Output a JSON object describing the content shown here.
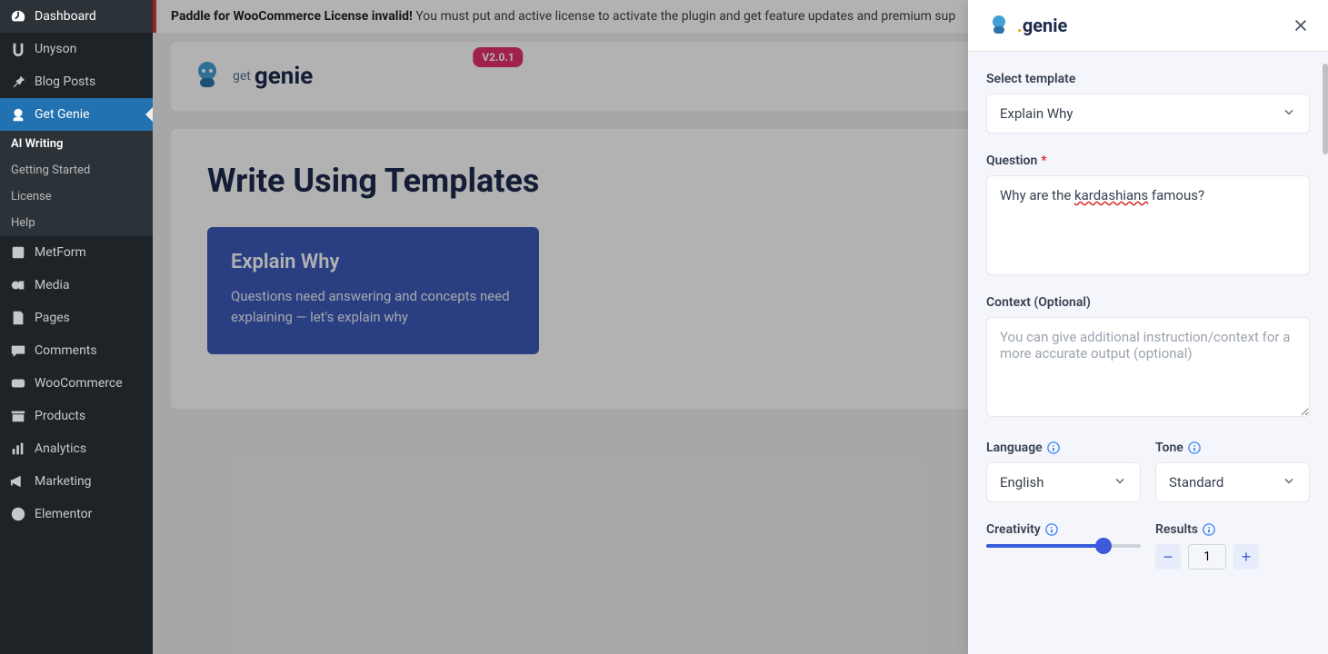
{
  "sidebar": {
    "items": [
      {
        "label": "Dashboard",
        "icon": "gauge"
      },
      {
        "label": "Unyson",
        "icon": "unyson"
      },
      {
        "label": "Blog Posts",
        "icon": "pin"
      },
      {
        "label": "Get Genie",
        "icon": "genie",
        "active": true
      },
      {
        "label": "MetForm",
        "icon": "doc"
      },
      {
        "label": "Media",
        "icon": "media"
      },
      {
        "label": "Pages",
        "icon": "page"
      },
      {
        "label": "Comments",
        "icon": "comment"
      },
      {
        "label": "WooCommerce",
        "icon": "woo"
      },
      {
        "label": "Products",
        "icon": "archive"
      },
      {
        "label": "Analytics",
        "icon": "bars"
      },
      {
        "label": "Marketing",
        "icon": "megaphone"
      },
      {
        "label": "Elementor",
        "icon": "elementor"
      }
    ],
    "sub_items": [
      {
        "label": "AI Writing",
        "active": true
      },
      {
        "label": "Getting Started"
      },
      {
        "label": "License"
      },
      {
        "label": "Help"
      }
    ]
  },
  "notice": {
    "strong": "Paddle for WooCommerce License invalid!",
    "text": " You must put and active license to activate the plugin and get feature updates and premium sup"
  },
  "brand": {
    "name": "genie",
    "version": "V2.0.1"
  },
  "content": {
    "heading": "Write Using Templates",
    "template_card": {
      "title": "Explain Why",
      "desc": "Questions need answering and concepts need explaining — let's explain why"
    }
  },
  "panel": {
    "brand": "genie",
    "template_label": "Select template",
    "template_value": "Explain Why",
    "question_label": "Question",
    "question_value_pre": "Why are the ",
    "question_value_mis": "kardashians",
    "question_value_post": " famous?",
    "context_label": "Context (Optional)",
    "context_placeholder": "You can give additional instruction/context for a more accurate output (optional)",
    "language_label": "Language",
    "language_value": "English",
    "tone_label": "Tone",
    "tone_value": "Standard",
    "creativity_label": "Creativity",
    "creativity_percent": 76,
    "results_label": "Results",
    "results_value": "1"
  }
}
